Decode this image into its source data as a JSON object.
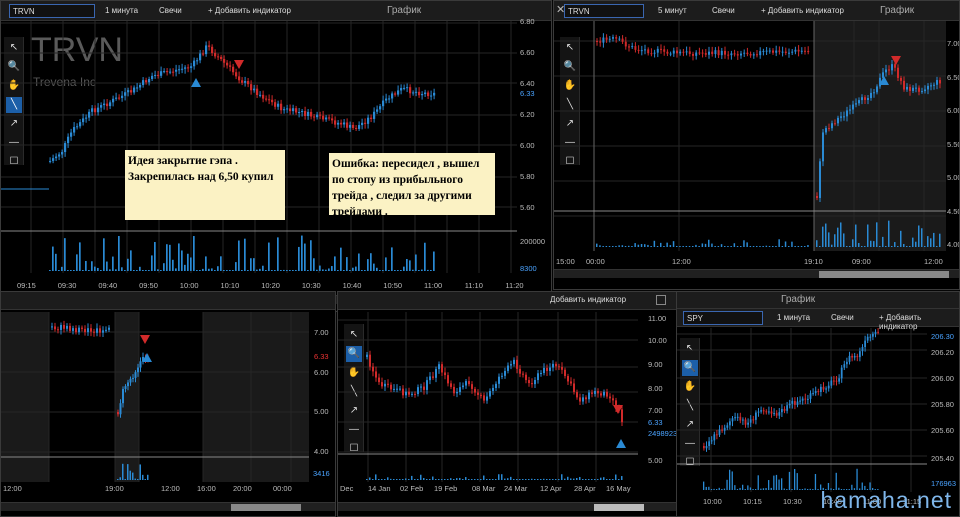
{
  "win1": {
    "symbol": "TRVN",
    "interval": "1 минута",
    "style": "Свечи",
    "add": "+ Добавить индикатор",
    "title": "График",
    "logo": "TRVN",
    "logo_sub": "Trevena Inc",
    "prices": [
      "6.80",
      "6.60",
      "6.40",
      "6.20",
      "6.00",
      "5.80",
      "5.60"
    ],
    "last": "6.33",
    "vol": "200000",
    "vol_last": "8300",
    "times": [
      "09:15",
      "09:30",
      "09:40",
      "09:50",
      "10:00",
      "10:10",
      "10:20",
      "10:30",
      "10:40",
      "10:50",
      "11:00",
      "11:10",
      "11:20"
    ],
    "note1": "Идея закрытие гэпа . Закрепилась над 6,50 купил",
    "note2": "Ошибка: пересидел , вышел по стопу из прибыльного трейда , следил за другими трейдами ."
  },
  "win2": {
    "symbol": "TRVN",
    "interval": "5 минут",
    "style": "Свечи",
    "add": "+ Добавить индикатор",
    "title": "График",
    "prices": [
      "7.00",
      "6.50",
      "6.00",
      "5.50",
      "5.00",
      "4.50",
      "4.00"
    ],
    "times": [
      "15:00",
      "00:00",
      "12:00",
      "19:10",
      "09:00",
      "12:00"
    ]
  },
  "win3": {
    "add": "Добавить индикатор",
    "prices": [
      "7.00",
      "6.33",
      "6.00",
      "5.00",
      "4.00"
    ],
    "vol": "3416",
    "times": [
      "12:00",
      "19:00",
      "12:00",
      "16:00",
      "20:00",
      "00:00"
    ]
  },
  "win4": {
    "prices": [
      "11.00",
      "10.00",
      "9.00",
      "8.00",
      "7.00",
      "6.33",
      "5.00"
    ],
    "vol": "2498923",
    "times": [
      "Dec",
      "14 Jan",
      "02 Feb",
      "19 Feb",
      "08 Mar",
      "24 Mar",
      "12 Apr",
      "28 Apr",
      "16 May"
    ]
  },
  "win5": {
    "symbol": "SPY",
    "interval": "1 минута",
    "style": "Свечи",
    "add": "+ Добавить индикатор",
    "title": "График",
    "prices": [
      "206.30",
      "206.20",
      "206.00",
      "205.80",
      "205.60",
      "205.40"
    ],
    "vol": "176963",
    "times": [
      "10:00",
      "10:15",
      "10:30",
      "10:45",
      "11:00",
      "11:15"
    ]
  },
  "watermark": "hamaha.net",
  "colors": {
    "up": "#2a8ad4",
    "down": "#d12a2a",
    "accent": "#1c5fa8"
  }
}
